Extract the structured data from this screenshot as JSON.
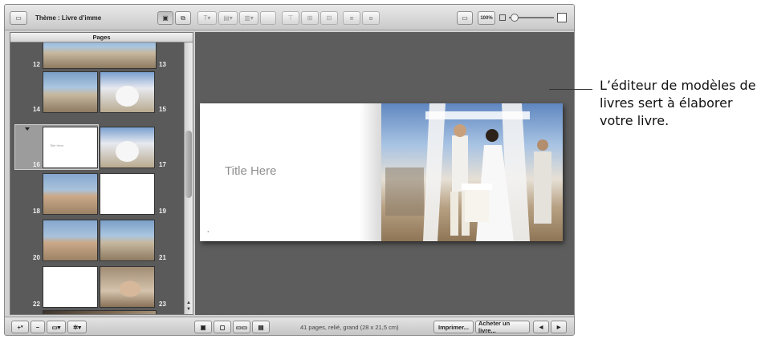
{
  "toolbar": {
    "theme_label": "Thème : Livre d’imme",
    "zoom_label": "100%"
  },
  "sidebar": {
    "header": "Pages",
    "page_numbers": [
      "12",
      "13",
      "14",
      "15",
      "16",
      "17",
      "18",
      "19",
      "20",
      "21",
      "22",
      "23"
    ],
    "selected_title": "Title Here"
  },
  "canvas": {
    "title_placeholder": "Title Here"
  },
  "bottombar": {
    "status": "41 pages, relié, grand (28 x 21,5 cm)",
    "print_label": "Imprimer...",
    "buy_label": "Acheter un livre...",
    "prev_label": "◀",
    "next_label": "▶",
    "add_label": "+",
    "remove_label": "−"
  },
  "callout": {
    "text": "L’éditeur de modèles de livres sert à élaborer votre livre."
  }
}
